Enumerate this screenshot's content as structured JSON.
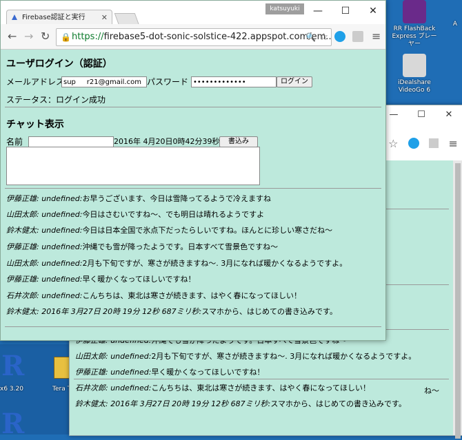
{
  "desktop": {
    "icons": [
      {
        "label": "RR FlashBack Express プレーヤー"
      },
      {
        "label": "iDealshare VideoGo 6"
      },
      {
        "label": "A"
      }
    ],
    "partial_labels": [
      "x6 3.20",
      "Tera T"
    ]
  },
  "browser": {
    "tab_title": "Firebase認証と実行",
    "user_badge": "katsuyuki",
    "url_prefix": "https://",
    "url_host": "firebase5-dot-sonic-solstice-422.appspot.com",
    "url_rest": "/em..."
  },
  "page": {
    "login_heading": "ユーザログイン（認証）",
    "email_label": "メールアドレス",
    "email_value": "sup     r21@gmail.com",
    "password_label": "パスワード",
    "password_value": "•••••••••••••",
    "login_button": "ログイン",
    "status_text": "ステータス：ログイン成功",
    "chat_heading": "チャット表示",
    "name_label": "名前",
    "name_value": "",
    "datetime": "2016年 4月20日0時42分39秒",
    "write_button": "書込み",
    "messages": [
      {
        "speaker": "伊藤正雄: undefined:",
        "text": "お早うございます、今日は雪降ってるようで冷えますね"
      },
      {
        "speaker": "山田太郎: undefined:",
        "text": "今日はさむいですね〜、でも明日は晴れるようですよ"
      },
      {
        "speaker": "鈴木健太: undefined:",
        "text": "今日は日本全国で氷点下だったらしいですね。ほんとに珍しい寒さだね〜"
      },
      {
        "speaker": "伊藤正雄: undefined:",
        "text": "沖縄でも雪が降ったようです。日本すべて雪景色ですね〜"
      },
      {
        "speaker": "山田太郎: undefined:",
        "text": "2月も下旬ですが、寒さが続きますね〜. 3月になれば暖かくなるようですよ。"
      },
      {
        "speaker": "伊藤正雄: undefined:",
        "text": "早く暖かくなってほしいですね！"
      },
      {
        "speaker": "石井次郎: undefined:",
        "text": "こんちちは、東北は寒さが続きます、はやく春になってほしい！"
      },
      {
        "speaker": "鈴木健太: 2016年 3月27日 20時 19分 12秒 687ミリ秒:",
        "text": "スマホから、はじめての書き込みです。"
      }
    ]
  },
  "back_window": {
    "tail_fragment": "ね〜",
    "messages": [
      {
        "speaker": "伊藤正雄: undefined:",
        "text": "沖縄でも雪が降ったようです。日本すべて雪景色ですね〜"
      },
      {
        "speaker": "山田太郎: undefined:",
        "text": "2月も下旬ですが、寒さが続きますね〜. 3月になれば暖かくなるようですよ。"
      },
      {
        "speaker": "伊藤正雄: undefined:",
        "text": "早く暖かくなってほしいですね！"
      },
      {
        "speaker": "石井次郎: undefined:",
        "text": "こんちちは、東北は寒さが続きます、はやく春になってほしい！"
      },
      {
        "speaker": "鈴木健太: 2016年 3月27日 20時 19分 12秒 687ミリ秒:",
        "text": "スマホから、はじめての書き込みです。"
      }
    ]
  },
  "colors": {
    "page_bg": "#bde9dc",
    "desktop_bg": "#1f6db5",
    "url_green": "#0a7a2a"
  },
  "icons": [
    "back-icon",
    "forward-icon",
    "reload-icon",
    "lock-icon",
    "zoom-icon",
    "star-icon",
    "skype-icon",
    "extension-icon",
    "menu-icon",
    "minimize-icon",
    "maximize-icon",
    "close-icon"
  ]
}
